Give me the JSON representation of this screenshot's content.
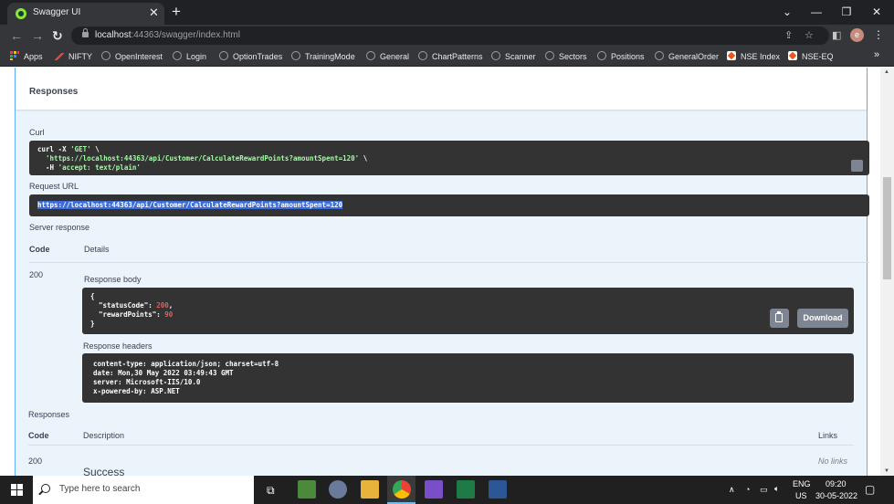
{
  "browser": {
    "tab_title": "Swagger UI",
    "url_host": "localhost",
    "url_port_path": ":44363/swagger/index.html",
    "bookmarks": [
      "Apps",
      "NIFTY",
      "OpenInterest",
      "Login",
      "OptionTrades",
      "TrainingMode",
      "General",
      "ChartPatterns",
      "Scanner",
      "Sectors",
      "Positions",
      "GeneralOrder",
      "NSE Index",
      "NSE-EQ"
    ],
    "profile_initial": "e"
  },
  "responses_section": {
    "title": "Responses",
    "curl_label": "Curl",
    "curl_line1": "curl -X ",
    "curl_method": "'GET'",
    "curl_line1_tail": " \\",
    "curl_line2": "'https://localhost:44363/api/Customer/CalculateRewardPoints?amountSpent=120'",
    "curl_line2_tail": " \\",
    "curl_line3": "-H ",
    "curl_header": "'accept: text/plain'",
    "request_url_label": "Request URL",
    "request_url": "https://localhost:44363/api/Customer/CalculateRewardPoints?amountSpent=120",
    "server_response_label": "Server response",
    "code_header": "Code",
    "details_header": "Details",
    "status_code": "200",
    "response_body_label": "Response body",
    "body_open": "{",
    "body_key1": "\"statusCode\"",
    "body_val1": "200",
    "body_key2": "\"rewardPoints\"",
    "body_val2": "90",
    "body_close": "}",
    "download_label": "Download",
    "response_headers_label": "Response headers",
    "headers": [
      "content-type: application/json; charset=utf-8",
      "date: Mon,30 May 2022 03:49:43 GMT",
      "server: Microsoft-IIS/10.0",
      "x-powered-by: ASP.NET"
    ]
  },
  "documented_responses": {
    "title": "Responses",
    "code_header": "Code",
    "description_header": "Description",
    "links_header": "Links",
    "code": "200",
    "description": "Success",
    "links": "No links"
  },
  "taskbar": {
    "search_placeholder": "Type here to search",
    "lang": "ENG",
    "region": "US",
    "time": "09:20",
    "date": "30-05-2022"
  },
  "colors": {
    "panel_bg": "#ebf3fb",
    "panel_border": "#61affe",
    "code_bg": "#333333",
    "string_green": "#a2fca2",
    "number_red": "#d36363",
    "button_gray": "#7d8492"
  }
}
